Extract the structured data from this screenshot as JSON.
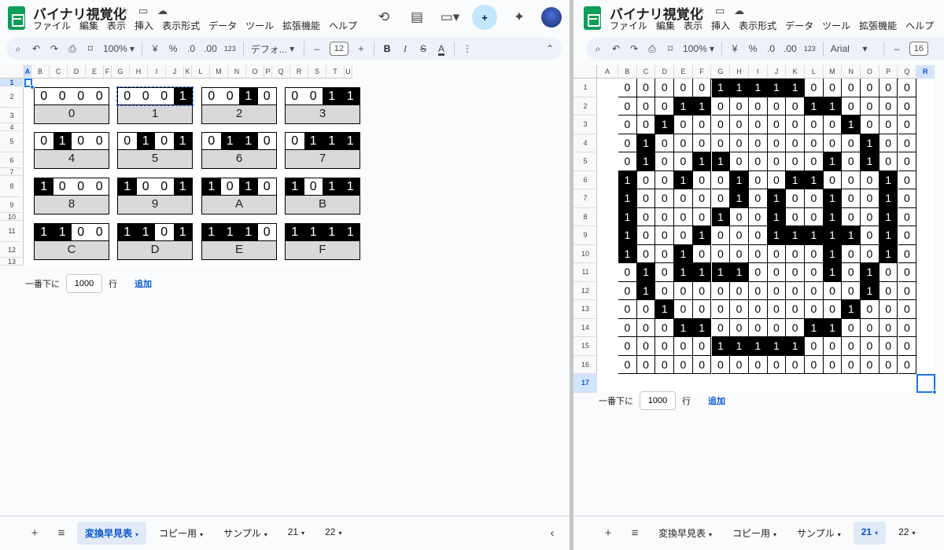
{
  "app": {
    "title": "バイナリ視覚化",
    "menu": [
      "ファイル",
      "編集",
      "表示",
      "挿入",
      "表示形式",
      "データ",
      "ツール",
      "拡張機能",
      "ヘルプ"
    ]
  },
  "icons": {
    "star": "star-icon",
    "folder": "folder-icon",
    "cloud": "cloud-icon",
    "history": "history-icon",
    "comment": "comment-icon",
    "meet": "video-icon",
    "share": "add-person-icon",
    "gemini": "sparkle-icon",
    "search": "search-icon",
    "undo": "undo-icon",
    "redo": "redo-icon",
    "print": "print-icon",
    "paint_format": "paint-roller-icon",
    "more": "more-vert-icon"
  },
  "left": {
    "toolbar": {
      "zoom": "100%",
      "currency": "¥",
      "percent": "%",
      "dec_decrease": ".0",
      "dec_increase": ".00",
      "number_format": "123",
      "font": "デフォ...",
      "font_size": "12",
      "minus": "–",
      "plus": "+",
      "bold": "B",
      "italic": "I",
      "strike": "S",
      "text_color": "A"
    },
    "columns": [
      "A",
      "B",
      "C",
      "D",
      "E",
      "F",
      "G",
      "H",
      "I",
      "J",
      "K",
      "L",
      "M",
      "N",
      "O",
      "P",
      "Q",
      "R",
      "S",
      "T",
      "U"
    ],
    "rows": [
      "1",
      "2",
      "3",
      "4",
      "5",
      "6",
      "7",
      "8",
      "9",
      "10",
      "11",
      "12",
      "13"
    ],
    "blocks": [
      {
        "bits": [
          "0",
          "0",
          "0",
          "0"
        ],
        "on": [
          0,
          0,
          0,
          0
        ],
        "hex": "0"
      },
      {
        "bits": [
          "0",
          "0",
          "0",
          "1"
        ],
        "on": [
          0,
          0,
          0,
          1
        ],
        "hex": "1"
      },
      {
        "bits": [
          "0",
          "0",
          "1",
          "0"
        ],
        "on": [
          0,
          0,
          1,
          0
        ],
        "hex": "2"
      },
      {
        "bits": [
          "0",
          "0",
          "1",
          "1"
        ],
        "on": [
          0,
          0,
          1,
          1
        ],
        "hex": "3"
      },
      {
        "bits": [
          "0",
          "1",
          "0",
          "0"
        ],
        "on": [
          0,
          1,
          0,
          0
        ],
        "hex": "4"
      },
      {
        "bits": [
          "0",
          "1",
          "0",
          "1"
        ],
        "on": [
          0,
          1,
          0,
          1
        ],
        "hex": "5"
      },
      {
        "bits": [
          "0",
          "1",
          "1",
          "0"
        ],
        "on": [
          0,
          1,
          1,
          0
        ],
        "hex": "6"
      },
      {
        "bits": [
          "0",
          "1",
          "1",
          "1"
        ],
        "on": [
          0,
          1,
          1,
          1
        ],
        "hex": "7"
      },
      {
        "bits": [
          "1",
          "0",
          "0",
          "0"
        ],
        "on": [
          1,
          0,
          0,
          0
        ],
        "hex": "8"
      },
      {
        "bits": [
          "1",
          "0",
          "0",
          "1"
        ],
        "on": [
          1,
          0,
          0,
          1
        ],
        "hex": "9"
      },
      {
        "bits": [
          "1",
          "0",
          "1",
          "0"
        ],
        "on": [
          1,
          0,
          1,
          0
        ],
        "hex": "A"
      },
      {
        "bits": [
          "1",
          "0",
          "1",
          "1"
        ],
        "on": [
          1,
          0,
          1,
          1
        ],
        "hex": "B"
      },
      {
        "bits": [
          "1",
          "1",
          "0",
          "0"
        ],
        "on": [
          1,
          1,
          0,
          0
        ],
        "hex": "C"
      },
      {
        "bits": [
          "1",
          "1",
          "0",
          "1"
        ],
        "on": [
          1,
          1,
          0,
          1
        ],
        "hex": "D"
      },
      {
        "bits": [
          "1",
          "1",
          "1",
          "0"
        ],
        "on": [
          1,
          1,
          1,
          0
        ],
        "hex": "E"
      },
      {
        "bits": [
          "1",
          "1",
          "1",
          "1"
        ],
        "on": [
          1,
          1,
          1,
          1
        ],
        "hex": "F"
      }
    ],
    "add_rows": {
      "prefix": "一番下に",
      "value": "1000",
      "unit": "行",
      "button": "追加"
    },
    "tabs": [
      "変換早見表",
      "コピー用",
      "サンプル",
      "21",
      "22"
    ],
    "active_tab": 0
  },
  "right": {
    "toolbar": {
      "zoom": "100%",
      "currency": "¥",
      "percent": "%",
      "dec_decrease": ".0",
      "dec_increase": ".00",
      "number_format": "123",
      "font": "Arial",
      "minus": "–",
      "font_size": "16"
    },
    "columns": [
      "A",
      "B",
      "C",
      "D",
      "E",
      "F",
      "G",
      "H",
      "I",
      "J",
      "K",
      "L",
      "M",
      "N",
      "O",
      "P",
      "Q",
      "R"
    ],
    "rows": [
      "1",
      "2",
      "3",
      "4",
      "5",
      "6",
      "7",
      "8",
      "9",
      "10",
      "11",
      "12",
      "13",
      "14",
      "15",
      "16",
      "17"
    ],
    "matrix": [
      "0000011111000000",
      "0001100000110000",
      "0010000000001000",
      "0100000000000100",
      "0100110000010100",
      "1001001001100010",
      "1000001010010010",
      "1000010010010010",
      "1000100011111010",
      "1001000000010010",
      "0101111000010100",
      "0100000000000100",
      "0010000000001000",
      "0001100000110000",
      "0000011111000000",
      "0000000000000000"
    ],
    "add_rows": {
      "prefix": "一番下に",
      "value": "1000",
      "unit": "行",
      "button": "追加"
    },
    "tabs": [
      "変換早見表",
      "コピー用",
      "サンプル",
      "21",
      "22"
    ],
    "active_tab": 3
  },
  "colors": {
    "accent": "#0b57d0",
    "sheets_green": "#0f9d58",
    "selection": "#1a73e8",
    "label_gray": "#d9d9d9"
  }
}
